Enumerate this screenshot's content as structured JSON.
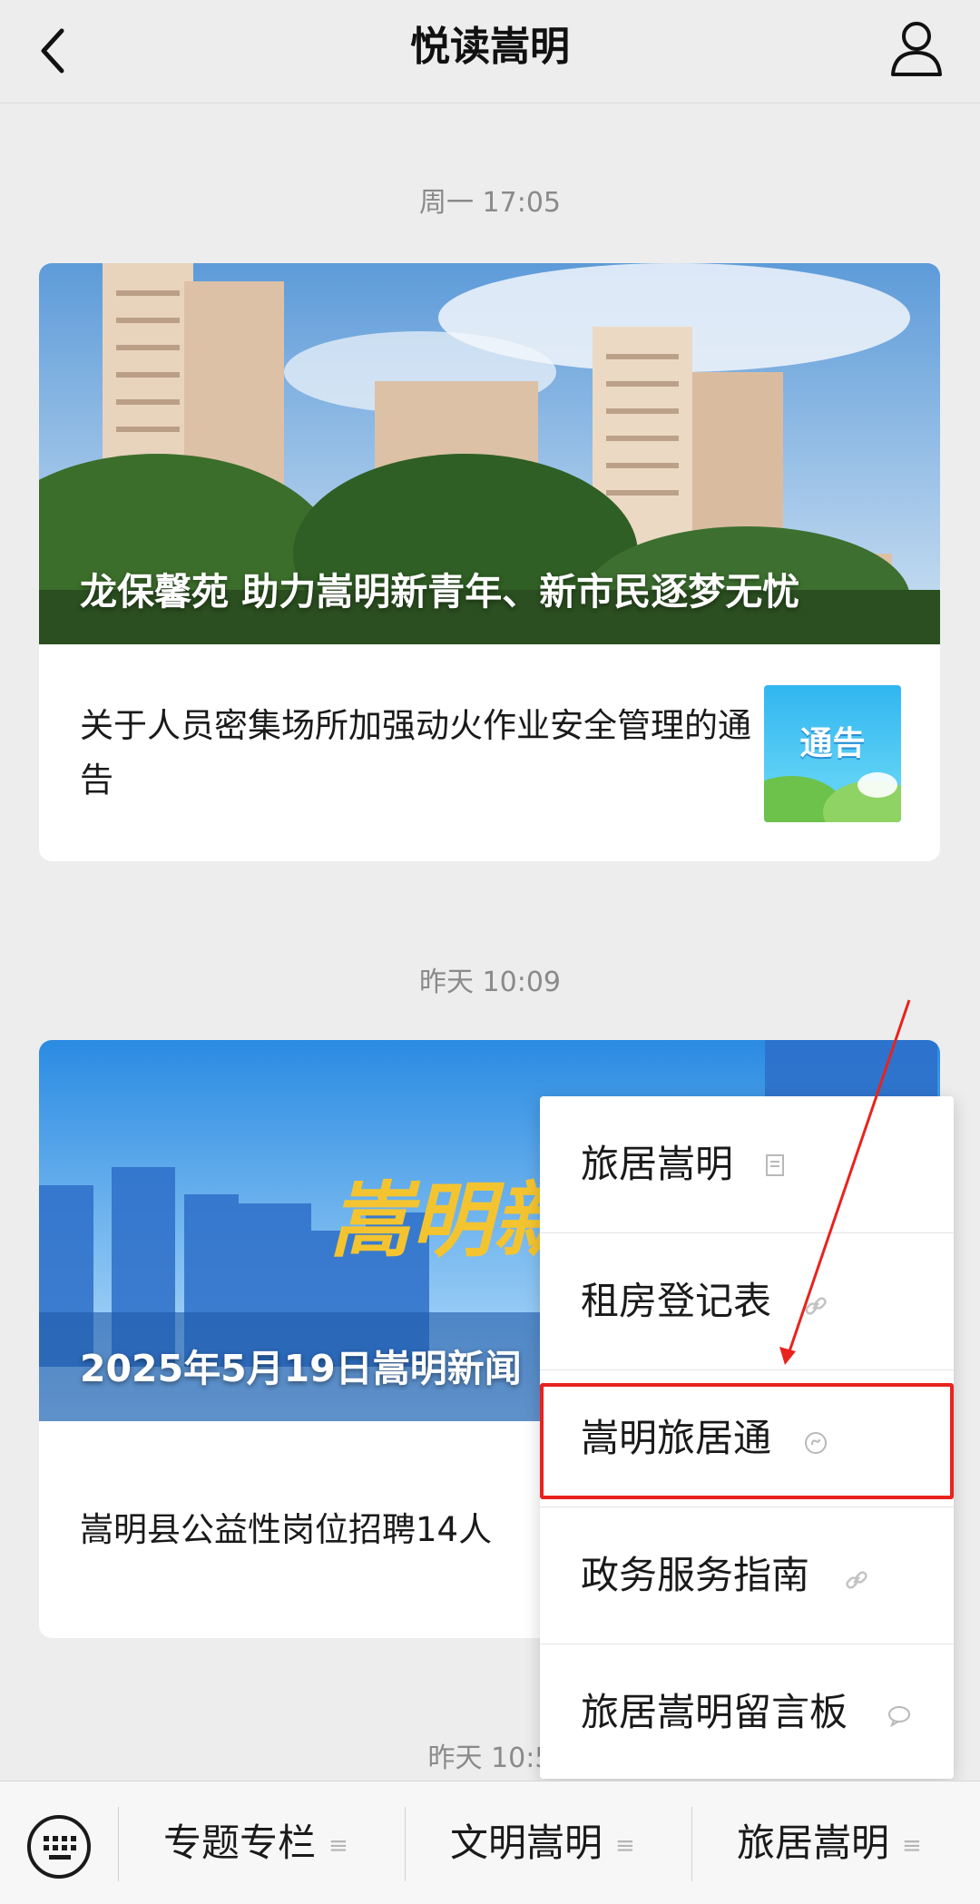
{
  "header": {
    "title": "悦读嵩明"
  },
  "timestamps": [
    "周一 17:05",
    "昨天 10:09",
    "昨天 10:5"
  ],
  "articles": [
    {
      "hero_caption": "龙保馨苑 助力嵩明新青年、新市民逐梦无忧",
      "item_text": "关于人员密集场所加强动火作业安全管理的通告",
      "thumb_label": "通告"
    },
    {
      "hero_caption": "2025年5月19日嵩明新闻",
      "hero_overlay": "嵩明新",
      "item_text": "嵩明县公益性岗位招聘14人"
    }
  ],
  "menu": {
    "items": [
      {
        "label": "旅居嵩明",
        "icon": "document-icon"
      },
      {
        "label": "租房登记表",
        "icon": "link-icon"
      },
      {
        "label": "嵩明旅居通",
        "icon": "mini-program-icon",
        "highlighted": true
      },
      {
        "label": "政务服务指南",
        "icon": "link-icon"
      },
      {
        "label": "旅居嵩明留言板",
        "icon": "chat-bubble-icon"
      }
    ]
  },
  "bottom_nav": {
    "items": [
      {
        "label": "专题专栏"
      },
      {
        "label": "文明嵩明"
      },
      {
        "label": "旅居嵩明"
      }
    ]
  },
  "colors": {
    "highlight": "#e8231e",
    "background": "#ededed"
  }
}
